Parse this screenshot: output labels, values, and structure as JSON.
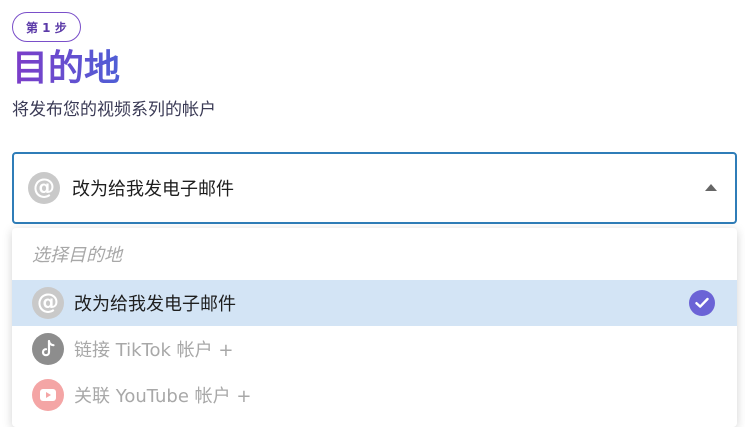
{
  "header": {
    "step_badge": "第 1 步",
    "title": "目的地",
    "subtitle": "将发布您的视频系列的帐户"
  },
  "destination_select": {
    "selected_value": "改为给我发电子邮件",
    "selected_icon": "at-sign-icon",
    "state": "expanded"
  },
  "dropdown": {
    "placeholder": "选择目的地",
    "options": [
      {
        "label": "改为给我发电子邮件",
        "icon": "at-sign-icon",
        "selected": true
      },
      {
        "label": "链接 TikTok 帐户 +",
        "icon": "tiktok-icon",
        "selected": false
      },
      {
        "label": "关联 YouTube 帐户 +",
        "icon": "youtube-icon",
        "selected": false
      }
    ]
  },
  "colors": {
    "accent_purple": "#6a3fd0",
    "select_border": "#2f7db8",
    "selected_row_bg": "#d3e4f5",
    "check_bg": "#6b63d6"
  }
}
